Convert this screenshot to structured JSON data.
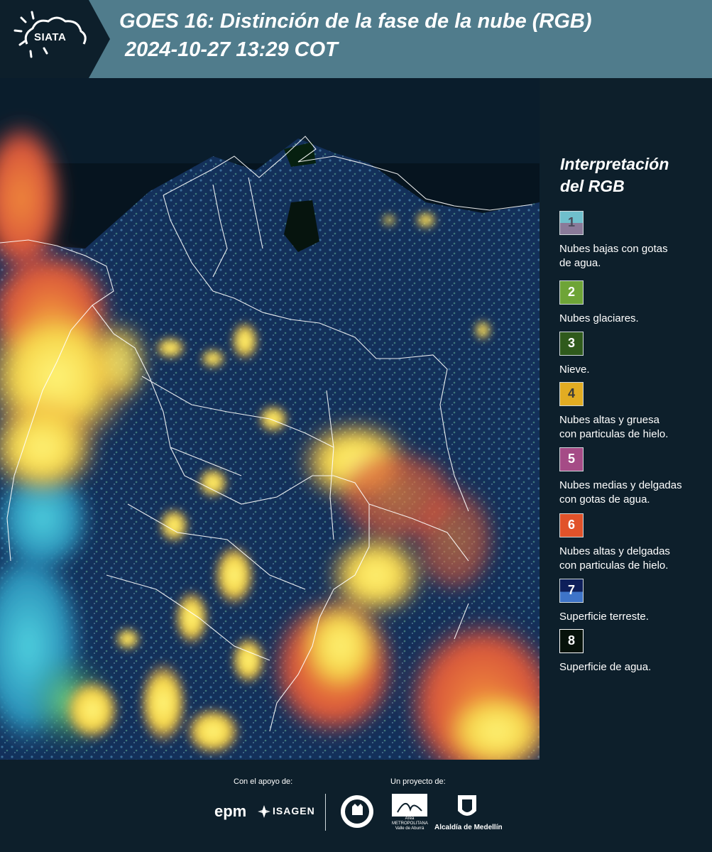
{
  "header": {
    "logo_text": "SIATA",
    "title_line1": "GOES 16: Distinción de la fase de la nube (RGB)",
    "title_line2": "2024-10-27 13:29 COT",
    "background_color": "#507c8c"
  },
  "legend": {
    "title_line1": "Interpretación",
    "title_line2": "del RGB",
    "items": [
      {
        "number": "1",
        "label_line1": "Nubes bajas con gotas",
        "label_line2": "de agua.",
        "color_top": "#6fbfcc",
        "color_bottom": "#8a7a99",
        "num_color": "#4a4a5a"
      },
      {
        "number": "2",
        "label_line1": "Nubes glaciares.",
        "label_line2": "",
        "color_top": "#6ea437",
        "color_bottom": "#6ea437",
        "num_color": "#ffffff"
      },
      {
        "number": "3",
        "label_line1": "Nieve.",
        "label_line2": "",
        "color_top": "#2f5a1c",
        "color_bottom": "#2f5a1c",
        "num_color": "#ffffff"
      },
      {
        "number": "4",
        "label_line1": "Nubes altas y gruesa",
        "label_line2": "con particulas de hielo.",
        "color_top": "#e2ac22",
        "color_bottom": "#e2ac22",
        "num_color": "#3a3a3a"
      },
      {
        "number": "5",
        "label_line1": "Nubes medias y delgadas",
        "label_line2": "con gotas de agua.",
        "color_top": "#a54b86",
        "color_bottom": "#a54b86",
        "num_color": "#ffffff"
      },
      {
        "number": "6",
        "label_line1": "Nubes altas y delgadas",
        "label_line2": "con particulas de hielo.",
        "color_top": "#e1522a",
        "color_bottom": "#e1522a",
        "num_color": "#ffffff"
      },
      {
        "number": "7",
        "label_line1": "Superficie terreste.",
        "label_line2": "",
        "color_top": "#0e1f5a",
        "color_bottom": "#3e74c8",
        "num_color": "#ffffff"
      },
      {
        "number": "8",
        "label_line1": "Superficie de agua.",
        "label_line2": "",
        "color_top": "#07120a",
        "color_bottom": "#07120a",
        "num_color": "#ffffff"
      }
    ]
  },
  "footer": {
    "support_label": "Con el apoyo de:",
    "project_label": "Un proyecto de:",
    "epm": "epm",
    "isagen": "ISAGEN",
    "metro_line1": "Área",
    "metro_line2": "METROPOLITANA",
    "metro_line3": "Valle de Aburrá",
    "alcaldia": "Alcaldía de Medellín"
  }
}
